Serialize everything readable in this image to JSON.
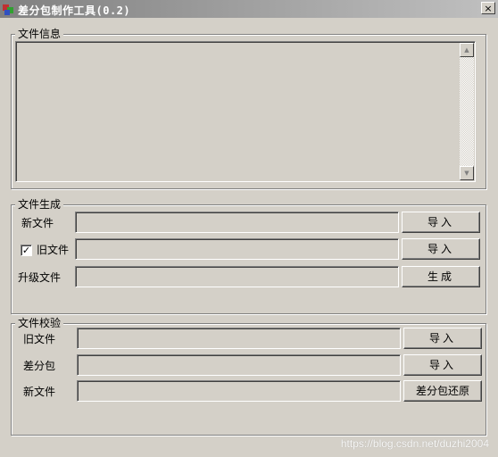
{
  "window": {
    "title": "差分包制作工具(0.2)",
    "close_glyph": "×",
    "icon": "app-icon"
  },
  "info_group": {
    "label": "文件信息",
    "log_text": "",
    "scroll_up_glyph": "▲",
    "scroll_down_glyph": "▼"
  },
  "gen_group": {
    "label": "文件生成",
    "new_file": {
      "label": "新文件",
      "value": "",
      "button": "导入"
    },
    "old_file": {
      "label": "旧文件",
      "checked": true,
      "check_glyph": "✓",
      "value": "",
      "button": "导入"
    },
    "upgrade_file": {
      "label": "升级文件",
      "value": "",
      "button": "生成"
    }
  },
  "verify_group": {
    "label": "文件校验",
    "old_file": {
      "label": "旧文件",
      "value": "",
      "button": "导入"
    },
    "diff_pkg": {
      "label": "差分包",
      "value": "",
      "button": "导入"
    },
    "new_file": {
      "label": "新文件",
      "value": "",
      "button": "差分包还原"
    }
  },
  "watermark": "https://blog.csdn.net/duzhi2004"
}
